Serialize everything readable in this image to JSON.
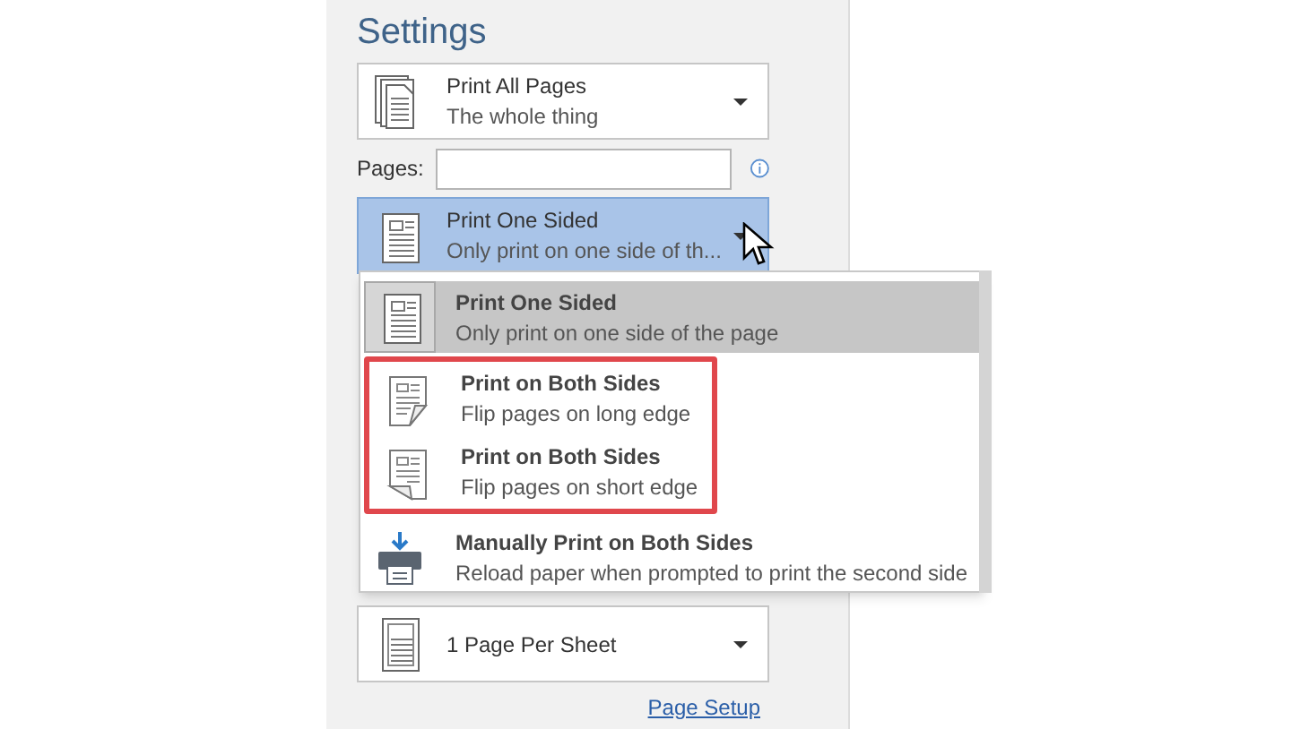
{
  "heading": "Settings",
  "pages_dropdown": {
    "title": "Print All Pages",
    "subtitle": "The whole thing"
  },
  "pages_field": {
    "label": "Pages:"
  },
  "sides_dropdown": {
    "title": "Print One Sided",
    "subtitle": "Only print on one side of th...",
    "open": true
  },
  "sides_menu": [
    {
      "kind": "one-sided",
      "title": "Print One Sided",
      "subtitle": "Only print on one side of the page",
      "selected": true,
      "highlighted": false
    },
    {
      "kind": "long-edge",
      "title": "Print on Both Sides",
      "subtitle": "Flip pages on long edge",
      "selected": false,
      "highlighted": true
    },
    {
      "kind": "short-edge",
      "title": "Print on Both Sides",
      "subtitle": "Flip pages on short edge",
      "selected": false,
      "highlighted": true
    },
    {
      "kind": "manual",
      "title": "Manually Print on Both Sides",
      "subtitle": "Reload paper when prompted to print the second side",
      "selected": false,
      "highlighted": false
    }
  ],
  "sheet_dropdown": {
    "title": "1 Page Per Sheet"
  },
  "page_setup_link": "Page Setup"
}
